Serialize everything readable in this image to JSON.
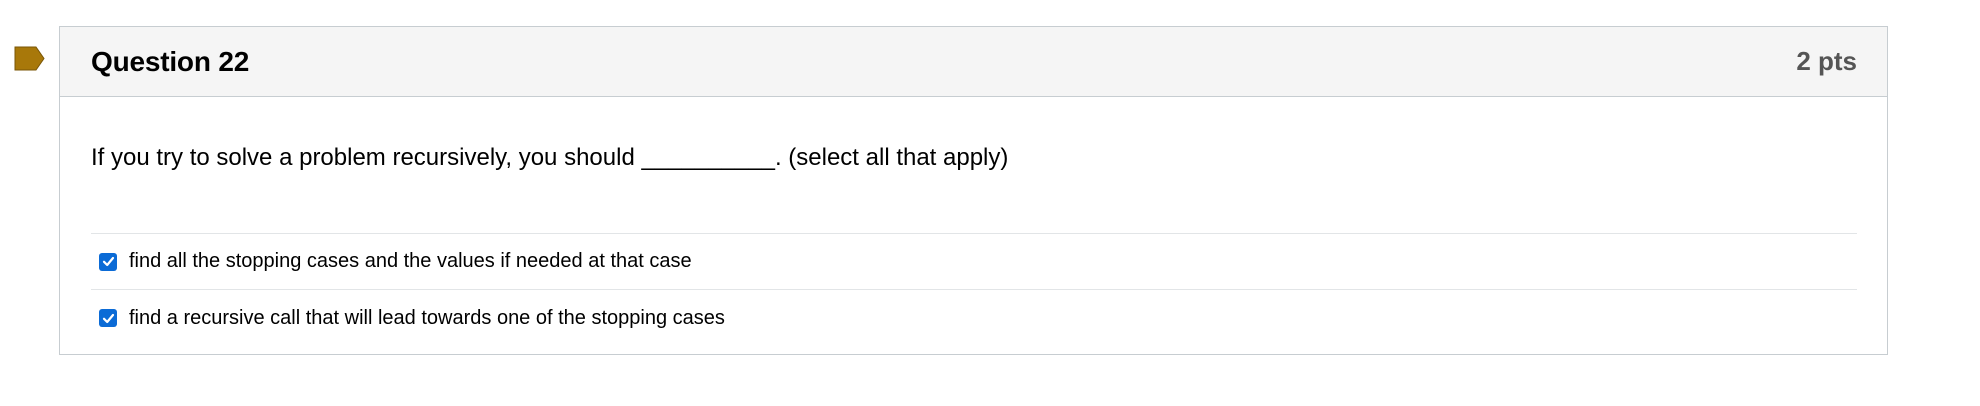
{
  "question": {
    "title": "Question 22",
    "points": "2 pts",
    "text": "If you try to solve a problem recursively, you should __________. (select all that apply)",
    "flag_icon": "flag-marker-icon",
    "accent_color": "#a8780a",
    "checkbox_color": "#0b6bd6",
    "answers": [
      {
        "label": "find all the stopping cases and the values if needed at that case",
        "checked": true
      },
      {
        "label": "find a recursive call that will lead towards one of the stopping cases",
        "checked": true
      }
    ]
  }
}
